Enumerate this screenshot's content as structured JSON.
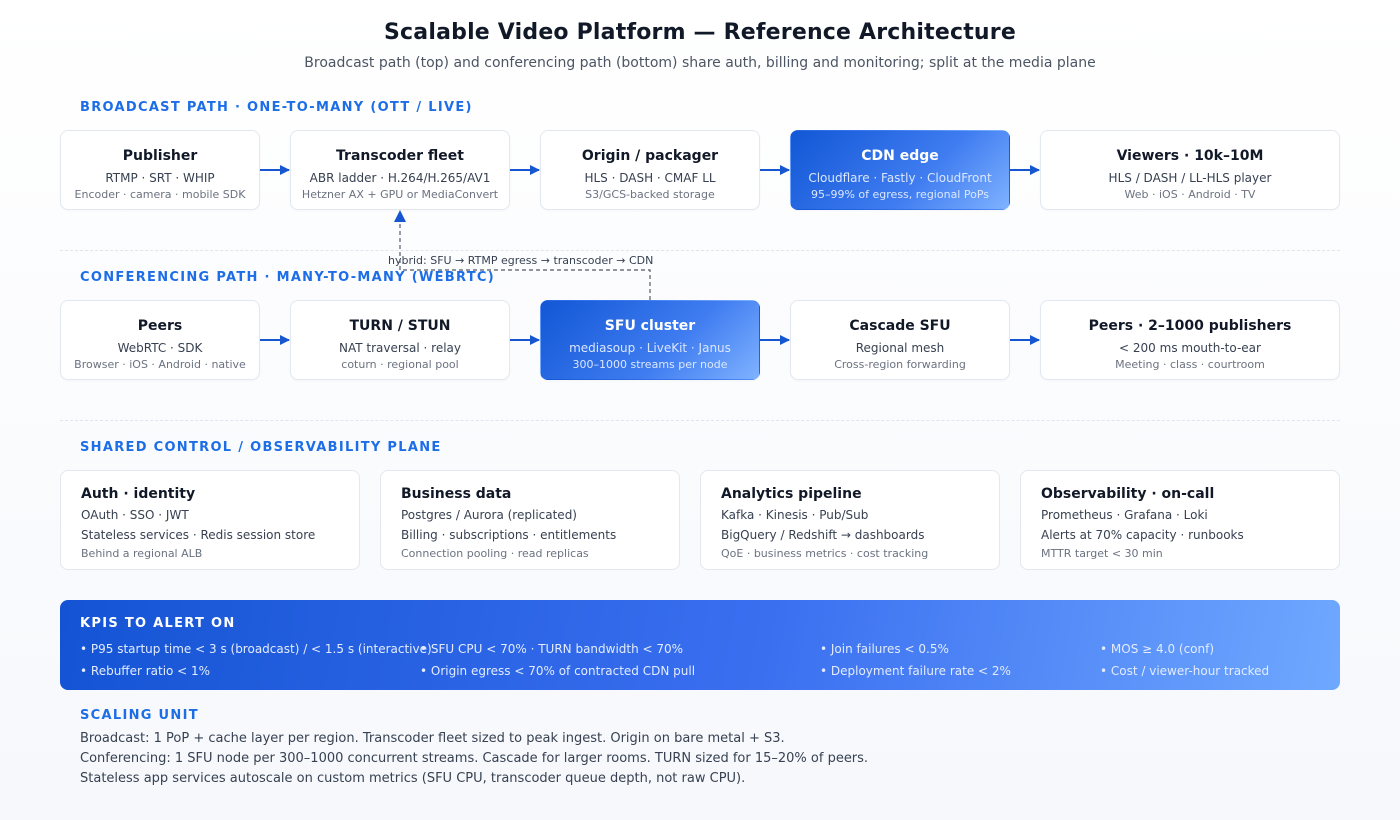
{
  "header": {
    "title": "Scalable Video Platform — Reference Architecture",
    "subtitle": "Broadcast path (top) and conferencing path (bottom) share auth, billing and monitoring; split at the media plane"
  },
  "broadcast": {
    "label": "BROADCAST PATH · ONE-TO-MANY (OTT / LIVE)",
    "nodes": [
      {
        "title": "Publisher",
        "sub": "RTMP · SRT · WHIP",
        "note": "Encoder · camera · mobile SDK"
      },
      {
        "title": "Transcoder fleet",
        "sub": "ABR ladder · H.264/H.265/AV1",
        "note": "Hetzner AX + GPU or MediaConvert"
      },
      {
        "title": "Origin / packager",
        "sub": "HLS · DASH · CMAF LL",
        "note": "S3/GCS-backed storage"
      },
      {
        "title": "CDN edge",
        "sub": "Cloudflare · Fastly · CloudFront",
        "note": "95–99% of egress, regional PoPs"
      },
      {
        "title": "Viewers · 10k–10M",
        "sub": "HLS / DASH / LL-HLS player",
        "note": "Web · iOS · Android · TV"
      }
    ]
  },
  "hybrid": {
    "label": "hybrid: SFU → RTMP egress → transcoder → CDN"
  },
  "conferencing": {
    "label": "CONFERENCING PATH · MANY-TO-MANY (WEBRTC)",
    "nodes": [
      {
        "title": "Peers",
        "sub": "WebRTC · SDK",
        "note": "Browser · iOS · Android · native"
      },
      {
        "title": "TURN / STUN",
        "sub": "NAT traversal · relay",
        "note": "coturn · regional pool"
      },
      {
        "title": "SFU cluster",
        "sub": "mediasoup · LiveKit · Janus",
        "note": "300–1000 streams per node"
      },
      {
        "title": "Cascade SFU",
        "sub": "Regional mesh",
        "note": "Cross-region forwarding"
      },
      {
        "title": "Peers · 2–1000 publishers",
        "sub": "< 200 ms mouth-to-ear",
        "note": "Meeting · class · courtroom"
      }
    ]
  },
  "shared": {
    "label": "SHARED CONTROL / OBSERVABILITY PLANE",
    "cards": [
      {
        "title": "Auth · identity",
        "line1": "OAuth · SSO · JWT",
        "line2": "Stateless services · Redis session store",
        "note": "Behind a regional ALB"
      },
      {
        "title": "Business data",
        "line1": "Postgres / Aurora (replicated)",
        "line2": "Billing · subscriptions · entitlements",
        "note": "Connection pooling · read replicas"
      },
      {
        "title": "Analytics pipeline",
        "line1": "Kafka · Kinesis · Pub/Sub",
        "line2": "BigQuery / Redshift → dashboards",
        "note": "QoE · business metrics · cost tracking"
      },
      {
        "title": "Observability · on-call",
        "line1": "Prometheus · Grafana · Loki",
        "line2": "Alerts at 70% capacity · runbooks",
        "note": "MTTR target < 30 min"
      }
    ]
  },
  "kpi": {
    "title": "KPIS TO ALERT ON",
    "row1": [
      "• P95 startup time < 3 s (broadcast) / < 1.5 s (interactive)",
      "• SFU CPU < 70% · TURN bandwidth < 70%",
      "• Join failures < 0.5%",
      "• MOS ≥ 4.0 (conf)"
    ],
    "row2": [
      "• Rebuffer ratio < 1%",
      "• Origin egress < 70% of contracted CDN pull",
      "• Deployment failure rate < 2%",
      "• Cost / viewer-hour tracked"
    ]
  },
  "scaling": {
    "label": "SCALING UNIT",
    "lines": [
      "Broadcast: 1 PoP + cache layer per region. Transcoder fleet sized to peak ingest. Origin on bare metal + S3.",
      "Conferencing: 1 SFU node per 300–1000 concurrent streams. Cascade for larger rooms. TURN sized for 15–20% of peers.",
      "Stateless app services autoscale on custom metrics (SFU CPU, transcoder queue depth, not raw CPU)."
    ]
  },
  "colors": {
    "accent": "#1d6ee6",
    "arrow": "#1657d1",
    "highlight_start": "#1257d6",
    "highlight_end": "#7fb2ff"
  }
}
